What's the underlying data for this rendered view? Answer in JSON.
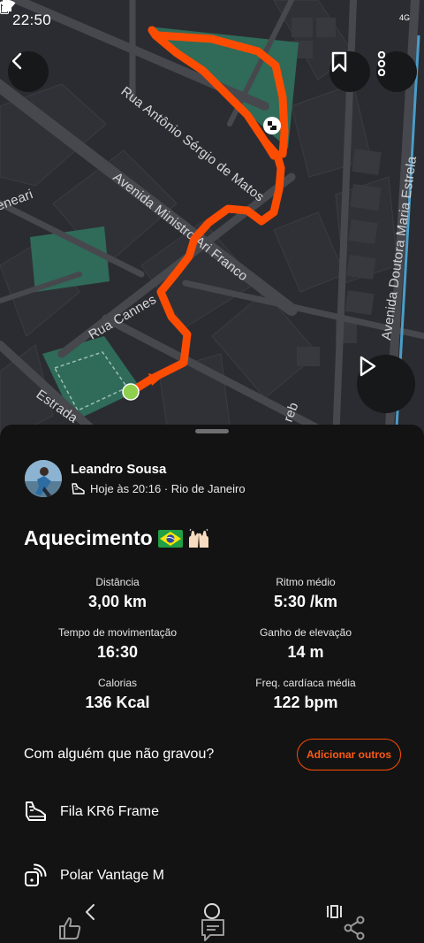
{
  "status_bar": {
    "time": "22:50",
    "network": "4G"
  },
  "map": {
    "streets": [
      "Rua Antônio Sérgio de Matos",
      "Avenida Ministro Ari Franco",
      "Avenida Doutora Maria Estrela",
      "Rua Cannes",
      "Estrada",
      "eneari",
      "reb"
    ],
    "route_color": "#fc4c02",
    "start_color": "#8fd14f"
  },
  "header": {
    "back_icon": "arrow-left-icon",
    "bookmark_icon": "bookmark-icon",
    "more_icon": "more-vertical-icon",
    "play_icon": "play-icon"
  },
  "athlete": {
    "name": "Leandro Sousa",
    "meta": "Hoje às 20:16 · Rio de Janeiro",
    "sport_icon": "shoe-icon"
  },
  "activity": {
    "title": "Aquecimento",
    "emojis": [
      "flag-brazil",
      "raised-hands"
    ]
  },
  "stats": [
    {
      "label": "Distância",
      "value": "3,00 km"
    },
    {
      "label": "Ritmo médio",
      "value": "5:30 /km"
    },
    {
      "label": "Tempo de movimentação",
      "value": "16:30"
    },
    {
      "label": "Ganho de elevação",
      "value": "14 m"
    },
    {
      "label": "Calorias",
      "value": "136 Kcal"
    },
    {
      "label": "Freq. cardíaca média",
      "value": "122 bpm"
    }
  ],
  "with_someone": {
    "text": "Com alguém que não gravou?",
    "button": "Adicionar outros"
  },
  "gear": [
    {
      "icon": "shoe-icon",
      "label": "Fila KR6 Frame"
    },
    {
      "icon": "watch-device-icon",
      "label": "Polar Vantage M"
    }
  ],
  "colors": {
    "accent": "#fc4c02",
    "sheet_bg": "#131313",
    "map_bg": "#2b2c31",
    "park": "#2f6b58"
  }
}
